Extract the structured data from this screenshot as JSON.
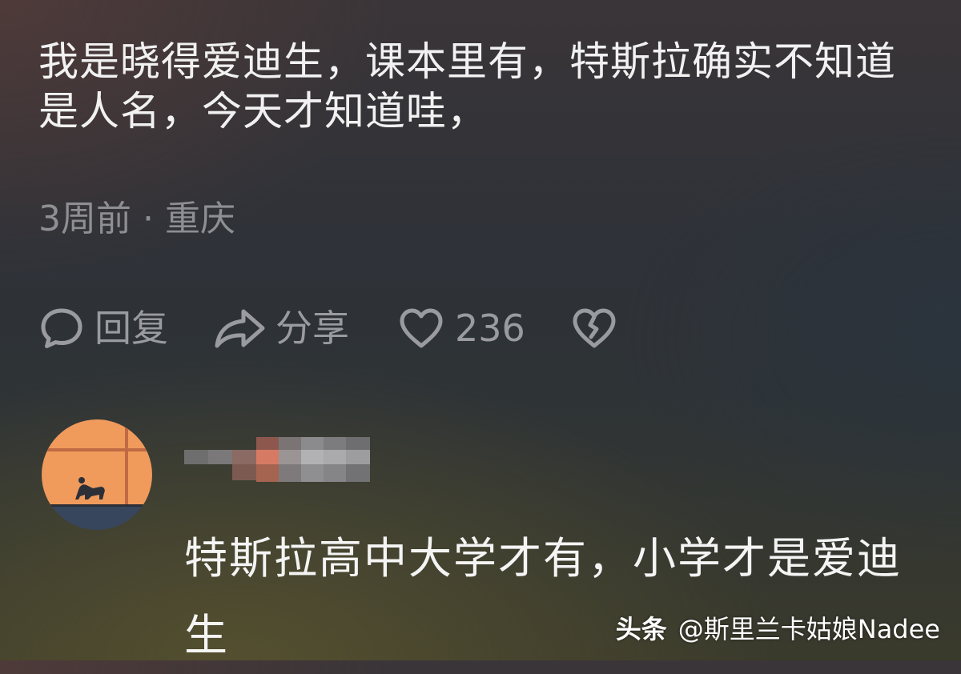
{
  "comment": {
    "text": "我是晓得爱迪生，课本里有，特斯拉确实不知道是人名，今天才知道哇，",
    "time_ago": "3周前",
    "separator": "·",
    "location": "重庆"
  },
  "actions": {
    "reply_label": "回复",
    "share_label": "分享",
    "like_count": "236"
  },
  "icons": {
    "reply": "speech-bubble-icon",
    "share": "share-arrow-icon",
    "like": "heart-icon",
    "dislike": "broken-heart-icon"
  },
  "reply": {
    "text": "特斯拉高中大学才有，小学才是爱迪生"
  },
  "watermark": {
    "brand": "头条",
    "handle": "@斯里兰卡姑娘Nadee"
  },
  "colors": {
    "text_primary": "#f1f1f1",
    "text_muted": "#8e8f93",
    "action_gray": "#9a9ba0",
    "avatar_orange": "#f09a5c",
    "avatar_navy": "#37465c"
  }
}
